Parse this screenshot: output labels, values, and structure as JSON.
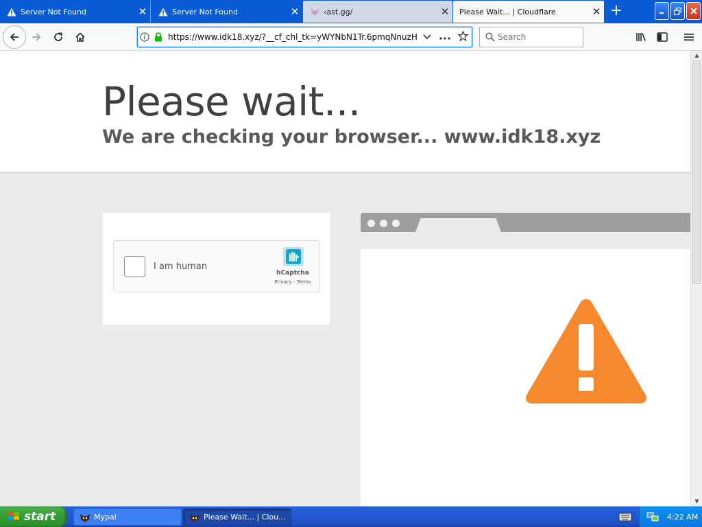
{
  "tabs": [
    {
      "title": "Server Not Found",
      "icon": "warning-icon",
      "active": false
    },
    {
      "title": "Server Not Found",
      "icon": "warning-icon",
      "active": false
    },
    {
      "title": "‹ast.gg/",
      "icon": "fox-favicon-icon",
      "active": false
    },
    {
      "title": "Please Wait... | Cloudflare",
      "icon": "",
      "active": true
    }
  ],
  "tab_close_glyph": "✕",
  "new_tab_glyph": "+",
  "navbar": {
    "url": "https://www.idk18.xyz/?__cf_chl_tk=yWYNbN1Tr.6pmqNnuzH",
    "search_placeholder": "Search"
  },
  "page": {
    "title": "Please wait...",
    "subtitle": "We are checking your browser... www.idk18.xyz"
  },
  "captcha": {
    "label": "I am human",
    "brand": "hCaptcha",
    "links": "Privacy - Terms"
  },
  "colors": {
    "warning": "#f6882d",
    "tab_bar": "#0a5bd6",
    "taskbar": "#245edb"
  },
  "taskbar": {
    "start_label": "start",
    "tasks": [
      {
        "label": "Mypal",
        "active": false
      },
      {
        "label": "Please Wait... | Clou...",
        "active": true
      }
    ],
    "clock": "4:22 AM"
  }
}
